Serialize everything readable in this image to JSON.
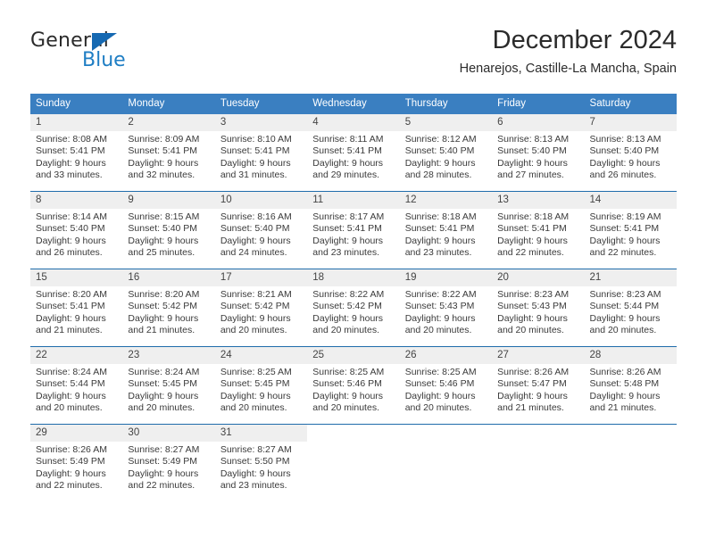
{
  "brand": {
    "name_part1": "General",
    "name_part2": "Blue",
    "triangle_icon": "blue-triangle-icon",
    "accent_color": "#1f7ec4"
  },
  "header": {
    "title": "December 2024",
    "subtitle": "Henarejos, Castille-La Mancha, Spain"
  },
  "calendar": {
    "header_bg": "#3a7fc1",
    "row_divider": "#1f6cab",
    "date_band_bg": "#efefef",
    "weekdays": [
      "Sunday",
      "Monday",
      "Tuesday",
      "Wednesday",
      "Thursday",
      "Friday",
      "Saturday"
    ],
    "weeks": [
      [
        {
          "day": "1",
          "sunrise": "Sunrise: 8:08 AM",
          "sunset": "Sunset: 5:41 PM",
          "daylight_line1": "Daylight: 9 hours",
          "daylight_line2": "and 33 minutes."
        },
        {
          "day": "2",
          "sunrise": "Sunrise: 8:09 AM",
          "sunset": "Sunset: 5:41 PM",
          "daylight_line1": "Daylight: 9 hours",
          "daylight_line2": "and 32 minutes."
        },
        {
          "day": "3",
          "sunrise": "Sunrise: 8:10 AM",
          "sunset": "Sunset: 5:41 PM",
          "daylight_line1": "Daylight: 9 hours",
          "daylight_line2": "and 31 minutes."
        },
        {
          "day": "4",
          "sunrise": "Sunrise: 8:11 AM",
          "sunset": "Sunset: 5:41 PM",
          "daylight_line1": "Daylight: 9 hours",
          "daylight_line2": "and 29 minutes."
        },
        {
          "day": "5",
          "sunrise": "Sunrise: 8:12 AM",
          "sunset": "Sunset: 5:40 PM",
          "daylight_line1": "Daylight: 9 hours",
          "daylight_line2": "and 28 minutes."
        },
        {
          "day": "6",
          "sunrise": "Sunrise: 8:13 AM",
          "sunset": "Sunset: 5:40 PM",
          "daylight_line1": "Daylight: 9 hours",
          "daylight_line2": "and 27 minutes."
        },
        {
          "day": "7",
          "sunrise": "Sunrise: 8:13 AM",
          "sunset": "Sunset: 5:40 PM",
          "daylight_line1": "Daylight: 9 hours",
          "daylight_line2": "and 26 minutes."
        }
      ],
      [
        {
          "day": "8",
          "sunrise": "Sunrise: 8:14 AM",
          "sunset": "Sunset: 5:40 PM",
          "daylight_line1": "Daylight: 9 hours",
          "daylight_line2": "and 26 minutes."
        },
        {
          "day": "9",
          "sunrise": "Sunrise: 8:15 AM",
          "sunset": "Sunset: 5:40 PM",
          "daylight_line1": "Daylight: 9 hours",
          "daylight_line2": "and 25 minutes."
        },
        {
          "day": "10",
          "sunrise": "Sunrise: 8:16 AM",
          "sunset": "Sunset: 5:40 PM",
          "daylight_line1": "Daylight: 9 hours",
          "daylight_line2": "and 24 minutes."
        },
        {
          "day": "11",
          "sunrise": "Sunrise: 8:17 AM",
          "sunset": "Sunset: 5:41 PM",
          "daylight_line1": "Daylight: 9 hours",
          "daylight_line2": "and 23 minutes."
        },
        {
          "day": "12",
          "sunrise": "Sunrise: 8:18 AM",
          "sunset": "Sunset: 5:41 PM",
          "daylight_line1": "Daylight: 9 hours",
          "daylight_line2": "and 23 minutes."
        },
        {
          "day": "13",
          "sunrise": "Sunrise: 8:18 AM",
          "sunset": "Sunset: 5:41 PM",
          "daylight_line1": "Daylight: 9 hours",
          "daylight_line2": "and 22 minutes."
        },
        {
          "day": "14",
          "sunrise": "Sunrise: 8:19 AM",
          "sunset": "Sunset: 5:41 PM",
          "daylight_line1": "Daylight: 9 hours",
          "daylight_line2": "and 22 minutes."
        }
      ],
      [
        {
          "day": "15",
          "sunrise": "Sunrise: 8:20 AM",
          "sunset": "Sunset: 5:41 PM",
          "daylight_line1": "Daylight: 9 hours",
          "daylight_line2": "and 21 minutes."
        },
        {
          "day": "16",
          "sunrise": "Sunrise: 8:20 AM",
          "sunset": "Sunset: 5:42 PM",
          "daylight_line1": "Daylight: 9 hours",
          "daylight_line2": "and 21 minutes."
        },
        {
          "day": "17",
          "sunrise": "Sunrise: 8:21 AM",
          "sunset": "Sunset: 5:42 PM",
          "daylight_line1": "Daylight: 9 hours",
          "daylight_line2": "and 20 minutes."
        },
        {
          "day": "18",
          "sunrise": "Sunrise: 8:22 AM",
          "sunset": "Sunset: 5:42 PM",
          "daylight_line1": "Daylight: 9 hours",
          "daylight_line2": "and 20 minutes."
        },
        {
          "day": "19",
          "sunrise": "Sunrise: 8:22 AM",
          "sunset": "Sunset: 5:43 PM",
          "daylight_line1": "Daylight: 9 hours",
          "daylight_line2": "and 20 minutes."
        },
        {
          "day": "20",
          "sunrise": "Sunrise: 8:23 AM",
          "sunset": "Sunset: 5:43 PM",
          "daylight_line1": "Daylight: 9 hours",
          "daylight_line2": "and 20 minutes."
        },
        {
          "day": "21",
          "sunrise": "Sunrise: 8:23 AM",
          "sunset": "Sunset: 5:44 PM",
          "daylight_line1": "Daylight: 9 hours",
          "daylight_line2": "and 20 minutes."
        }
      ],
      [
        {
          "day": "22",
          "sunrise": "Sunrise: 8:24 AM",
          "sunset": "Sunset: 5:44 PM",
          "daylight_line1": "Daylight: 9 hours",
          "daylight_line2": "and 20 minutes."
        },
        {
          "day": "23",
          "sunrise": "Sunrise: 8:24 AM",
          "sunset": "Sunset: 5:45 PM",
          "daylight_line1": "Daylight: 9 hours",
          "daylight_line2": "and 20 minutes."
        },
        {
          "day": "24",
          "sunrise": "Sunrise: 8:25 AM",
          "sunset": "Sunset: 5:45 PM",
          "daylight_line1": "Daylight: 9 hours",
          "daylight_line2": "and 20 minutes."
        },
        {
          "day": "25",
          "sunrise": "Sunrise: 8:25 AM",
          "sunset": "Sunset: 5:46 PM",
          "daylight_line1": "Daylight: 9 hours",
          "daylight_line2": "and 20 minutes."
        },
        {
          "day": "26",
          "sunrise": "Sunrise: 8:25 AM",
          "sunset": "Sunset: 5:46 PM",
          "daylight_line1": "Daylight: 9 hours",
          "daylight_line2": "and 20 minutes."
        },
        {
          "day": "27",
          "sunrise": "Sunrise: 8:26 AM",
          "sunset": "Sunset: 5:47 PM",
          "daylight_line1": "Daylight: 9 hours",
          "daylight_line2": "and 21 minutes."
        },
        {
          "day": "28",
          "sunrise": "Sunrise: 8:26 AM",
          "sunset": "Sunset: 5:48 PM",
          "daylight_line1": "Daylight: 9 hours",
          "daylight_line2": "and 21 minutes."
        }
      ],
      [
        {
          "day": "29",
          "sunrise": "Sunrise: 8:26 AM",
          "sunset": "Sunset: 5:49 PM",
          "daylight_line1": "Daylight: 9 hours",
          "daylight_line2": "and 22 minutes."
        },
        {
          "day": "30",
          "sunrise": "Sunrise: 8:27 AM",
          "sunset": "Sunset: 5:49 PM",
          "daylight_line1": "Daylight: 9 hours",
          "daylight_line2": "and 22 minutes."
        },
        {
          "day": "31",
          "sunrise": "Sunrise: 8:27 AM",
          "sunset": "Sunset: 5:50 PM",
          "daylight_line1": "Daylight: 9 hours",
          "daylight_line2": "and 23 minutes."
        },
        {
          "day": "",
          "sunrise": "",
          "sunset": "",
          "daylight_line1": "",
          "daylight_line2": ""
        },
        {
          "day": "",
          "sunrise": "",
          "sunset": "",
          "daylight_line1": "",
          "daylight_line2": ""
        },
        {
          "day": "",
          "sunrise": "",
          "sunset": "",
          "daylight_line1": "",
          "daylight_line2": ""
        },
        {
          "day": "",
          "sunrise": "",
          "sunset": "",
          "daylight_line1": "",
          "daylight_line2": ""
        }
      ]
    ]
  }
}
